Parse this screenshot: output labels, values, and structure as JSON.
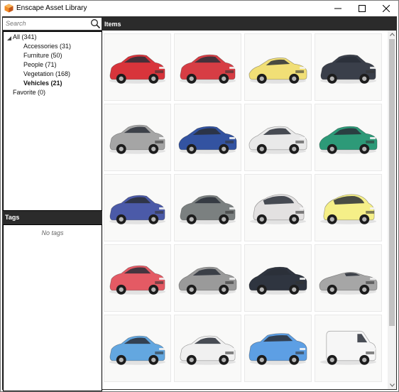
{
  "window": {
    "title": "Enscape Asset Library"
  },
  "search": {
    "placeholder": "Search"
  },
  "tree": {
    "items": [
      {
        "label": "All (341)",
        "expanded": true
      },
      {
        "label": "Accessories (31)"
      },
      {
        "label": "Furniture (50)"
      },
      {
        "label": "People (71)"
      },
      {
        "label": "Vegetation (168)"
      },
      {
        "label": "Vehicles (21)",
        "selected": true
      },
      {
        "label": "Favorite (0)"
      }
    ]
  },
  "tags": {
    "header": "Tags",
    "empty_text": "No tags"
  },
  "items": {
    "header": "Items",
    "thumbnails": [
      {
        "kind": "hatchback",
        "color": "#d8343b"
      },
      {
        "kind": "hatchback",
        "color": "#d73d44"
      },
      {
        "kind": "sports",
        "color": "#f1df76"
      },
      {
        "kind": "hatchback",
        "color": "#3a3f4a"
      },
      {
        "kind": "hatchback",
        "color": "#a5a5a5"
      },
      {
        "kind": "sedan",
        "color": "#3353a1"
      },
      {
        "kind": "sedan",
        "color": "#e9e9e9"
      },
      {
        "kind": "sedan",
        "color": "#2d9a78"
      },
      {
        "kind": "hatchback",
        "color": "#4b5aa8"
      },
      {
        "kind": "hatchback",
        "color": "#7b8080"
      },
      {
        "kind": "city",
        "color": "#e3e1e1"
      },
      {
        "kind": "city",
        "color": "#f5ef88"
      },
      {
        "kind": "hatchback",
        "color": "#e45a64"
      },
      {
        "kind": "sedan",
        "color": "#9a9a9a"
      },
      {
        "kind": "sedan",
        "color": "#2f3540"
      },
      {
        "kind": "convertible",
        "color": "#a6a6a6"
      },
      {
        "kind": "hatchback",
        "color": "#63a7e0"
      },
      {
        "kind": "hatchback",
        "color": "#f0f0f0"
      },
      {
        "kind": "suv",
        "color": "#5d9fe4"
      },
      {
        "kind": "van",
        "color": "#f6f6f6"
      }
    ]
  }
}
